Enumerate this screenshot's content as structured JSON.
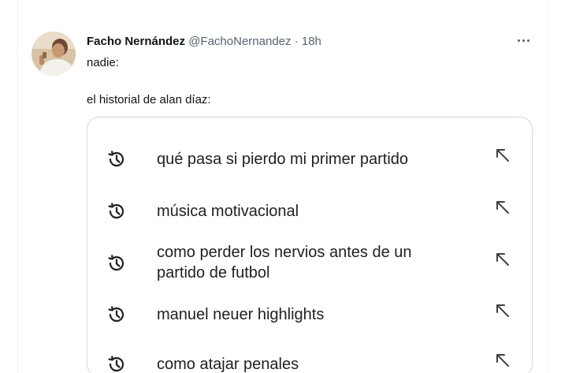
{
  "tweet": {
    "author_name": "Facho Nernández",
    "author_handle": "@FachoNernandez",
    "separator": "·",
    "time": "18h",
    "text_line1": "nadie:",
    "text_line2": "el historial de alan díaz:"
  },
  "history": {
    "items": [
      {
        "text": "qué pasa si pierdo mi primer partido",
        "icon": "history-clock-icon",
        "action_icon": "arrow-up-left-icon"
      },
      {
        "text": "música motivacional",
        "icon": "history-clock-icon",
        "action_icon": "arrow-up-left-icon"
      },
      {
        "text": "como perder los nervios antes de un partido de futbol",
        "icon": "history-clock-icon",
        "action_icon": "arrow-up-left-icon"
      },
      {
        "text": "manuel neuer highlights",
        "icon": "history-clock-icon",
        "action_icon": "arrow-up-left-icon"
      },
      {
        "text": "como atajar penales",
        "icon": "history-clock-icon",
        "action_icon": "arrow-up-left-icon"
      }
    ]
  },
  "colors": {
    "text_primary": "#0f1419",
    "text_secondary": "#536471",
    "card_border": "#cfd9de",
    "history_text": "#202124"
  }
}
